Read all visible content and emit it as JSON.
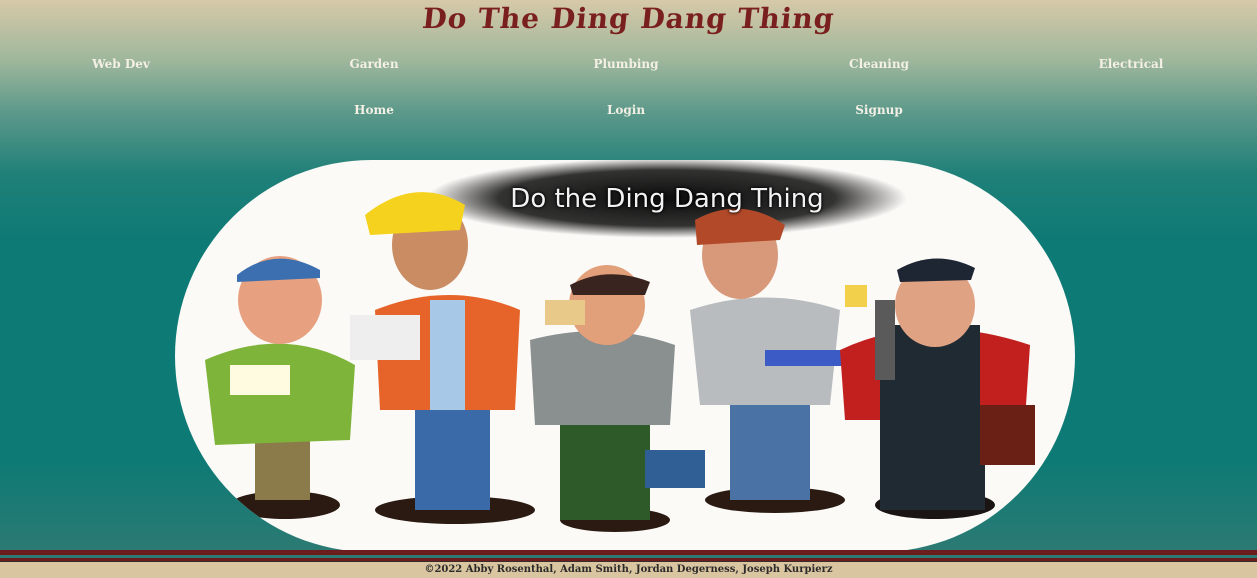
{
  "site": {
    "title": "Do The Ding Dang Thing"
  },
  "nav": {
    "top": [
      {
        "label": "Web Dev"
      },
      {
        "label": "Garden"
      },
      {
        "label": "Plumbing"
      },
      {
        "label": "Cleaning"
      },
      {
        "label": "Electrical"
      }
    ],
    "bottom": [
      {
        "label": "Home"
      },
      {
        "label": "Login"
      },
      {
        "label": "Signup"
      }
    ]
  },
  "hero": {
    "caption": "Do the Ding Dang Thing"
  },
  "footer": {
    "text": "©2022 Abby Rosenthal, Adam Smith, Jordan Degerness, Joseph Kurpierz"
  },
  "colors": {
    "title": "#7a1f1f",
    "teal": "#0e7a75",
    "footer_bar": "#6b1d1d",
    "footer_bg": "#d9c6a1"
  }
}
